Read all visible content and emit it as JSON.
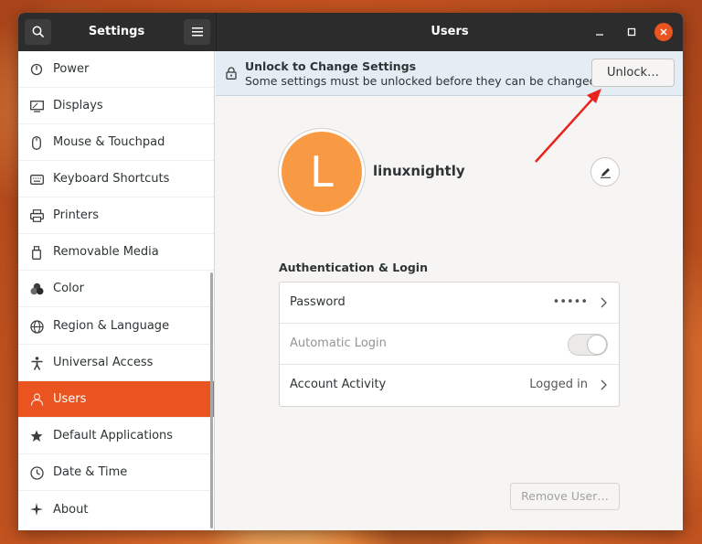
{
  "titlebar": {
    "sidebar_title": "Settings",
    "main_title": "Users"
  },
  "sidebar": {
    "items": [
      {
        "label": "Power",
        "icon": "power-icon"
      },
      {
        "label": "Displays",
        "icon": "display-icon"
      },
      {
        "label": "Mouse & Touchpad",
        "icon": "mouse-icon"
      },
      {
        "label": "Keyboard Shortcuts",
        "icon": "keyboard-icon"
      },
      {
        "label": "Printers",
        "icon": "printer-icon"
      },
      {
        "label": "Removable Media",
        "icon": "usb-icon"
      },
      {
        "label": "Color",
        "icon": "color-icon"
      },
      {
        "label": "Region & Language",
        "icon": "globe-icon"
      },
      {
        "label": "Universal Access",
        "icon": "accessibility-icon"
      },
      {
        "label": "Users",
        "icon": "users-icon",
        "active": true
      },
      {
        "label": "Default Applications",
        "icon": "star-icon"
      },
      {
        "label": "Date & Time",
        "icon": "clock-icon"
      },
      {
        "label": "About",
        "icon": "sparkle-icon"
      }
    ]
  },
  "infobar": {
    "title": "Unlock to Change Settings",
    "subtitle": "Some settings must be unlocked before they can be changed.",
    "unlock_label": "Unlock…"
  },
  "user": {
    "avatar_letter": "L",
    "name": "linuxnightly"
  },
  "auth": {
    "section_title": "Authentication & Login",
    "rows": [
      {
        "label": "Password",
        "value": "•••••"
      },
      {
        "label": "Automatic Login",
        "value": ""
      },
      {
        "label": "Account Activity",
        "value": "Logged in"
      }
    ]
  },
  "remove_label": "Remove User…",
  "colors": {
    "accent": "#e95420",
    "titlebar": "#2c2c2c",
    "avatar": "#f89a44",
    "infobar": "#e3edf3"
  }
}
